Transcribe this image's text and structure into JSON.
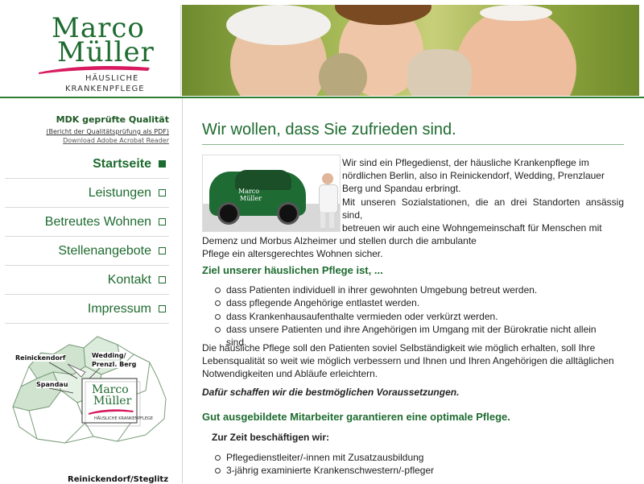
{
  "logo": {
    "line1": "Marco",
    "line2": "Müller",
    "sub1": "HÄUSLICHE",
    "sub2": "KRANKENPFLEGE"
  },
  "quality": {
    "title": "MDK geprüfte Qualität",
    "report_link": "(Bericht der Qualitätsprüfung als PDF)",
    "acrobat_link": "Download Adobe Acrobat Reader"
  },
  "nav": [
    {
      "label": "Startseite",
      "active": true
    },
    {
      "label": "Leistungen"
    },
    {
      "label": "Betreutes Wohnen"
    },
    {
      "label": "Stellenangebote"
    },
    {
      "label": "Kontakt"
    },
    {
      "label": "Impressum"
    }
  ],
  "map": {
    "label_reinickendorf": "Reinickendorf",
    "label_wedding": "Wedding/",
    "label_prenzl": "Prenzl. Berg",
    "label_spandau": "Spandau",
    "logo_line1": "Marco",
    "logo_line2": "Müller",
    "logo_sub": "HÄUSLICHE KRANKENPFLEGE"
  },
  "sidebar_bottom": "Reinickendorf/Steglitz",
  "car": {
    "logo_line1": "Marco",
    "logo_line2": "Müller"
  },
  "main": {
    "title": "Wir wollen, dass Sie zufrieden sind.",
    "intro_lines": [
      "Wir sind ein Pflegedienst, der häusliche Krankenpflege im",
      "nördlichen Berlin, also in Reinickendorf, Wedding, Prenzlauer",
      "Berg und Spandau erbringt.",
      "Mit unseren Sozialstationen, die an drei Standorten ansässig sind,",
      "betreuen wir auch eine Wohngemeinschaft für Menschen mit",
      "Demenz und Morbus Alzheimer und stellen durch die ambulante",
      "Pflege ein altersgerechtes Wohnen sicher."
    ],
    "goal_heading": "Ziel unserer häuslichen Pflege ist, ...",
    "goals": [
      "dass Patienten individuell in ihrer gewohnten Umgebung betreut werden.",
      "dass pflegende Angehörige entlastet werden.",
      "dass Krankenhausaufenthalte vermieden oder verkürzt werden.",
      "dass unsere Patienten und ihre Angehörigen im Umgang mit der Bürokratie nicht allein sind."
    ],
    "para2_lines": [
      "Die häusliche Pflege soll den Patienten soviel Selbständigkeit wie möglich erhalten, soll Ihre",
      "Lebensqualität so weit wie möglich verbessern und Ihnen und Ihren Angehörigen die alltäglichen",
      "Notwendigkeiten und Abläufe erleichtern."
    ],
    "emphasis": "Dafür schaffen wir die bestmöglichen Voraussetzungen.",
    "staff_heading": "Gut ausgebildete Mitarbeiter garantieren eine optimale Pflege.",
    "staff_sub": "Zur Zeit beschäftigen wir:",
    "staff": [
      "Pflegedienstleiter/-innen mit Zusatzausbildung",
      "3-jährig examinierte Krankenschwestern/-pfleger"
    ]
  },
  "colors": {
    "accent": "#1e6b2f",
    "border": "#2e7d32"
  }
}
